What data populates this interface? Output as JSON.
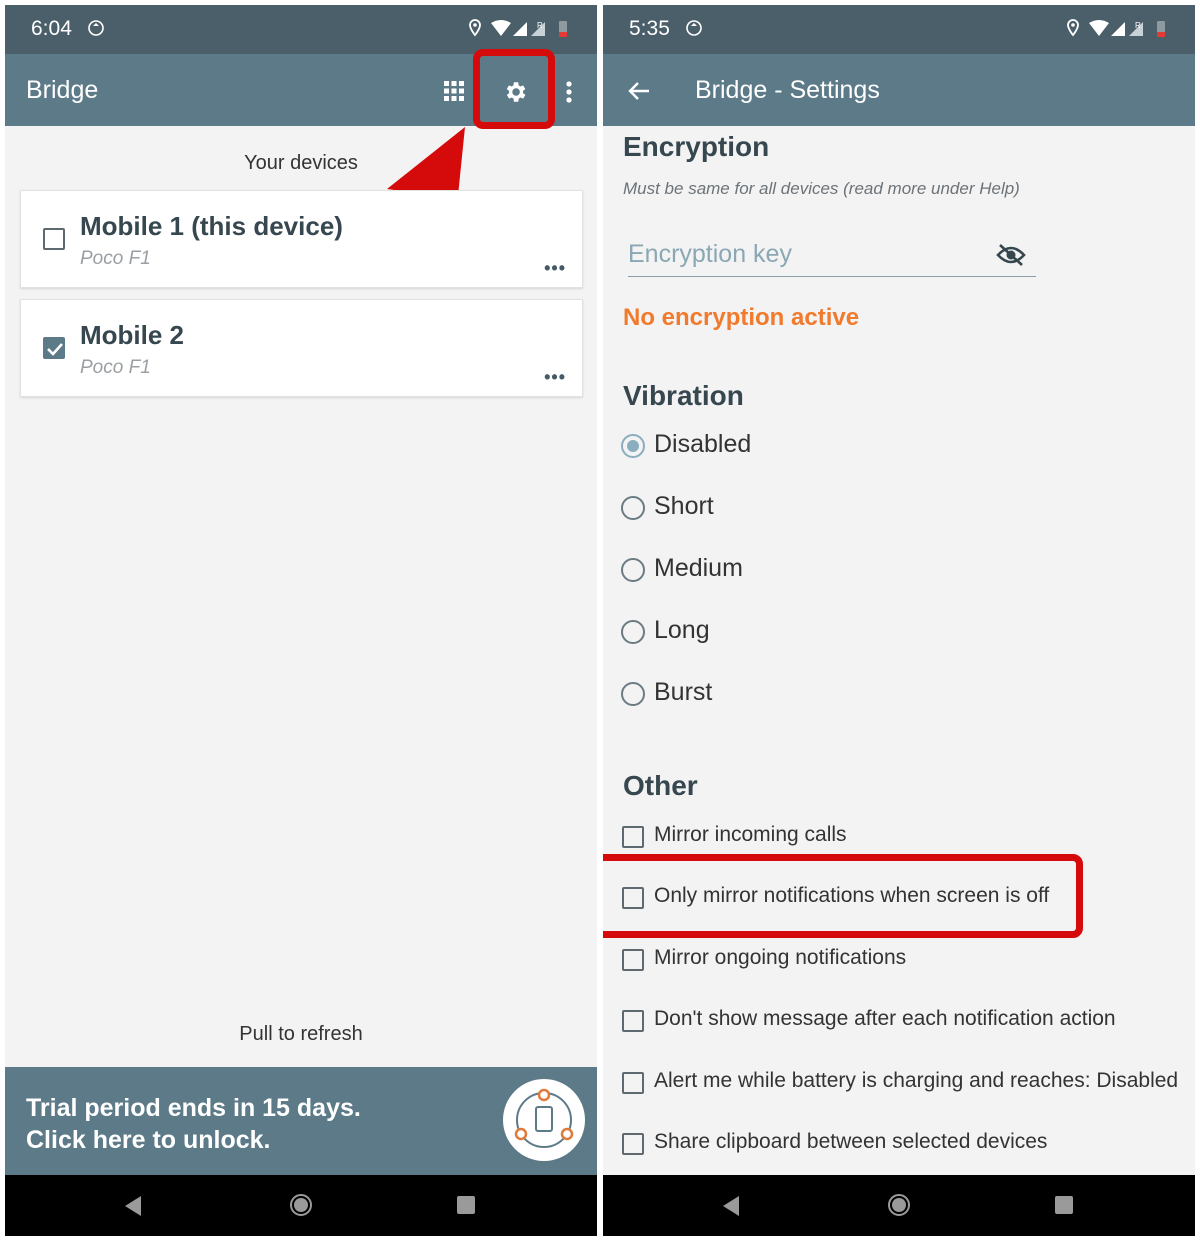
{
  "left": {
    "status": {
      "time": "6:04"
    },
    "appbar": {
      "title": "Bridge",
      "icons": [
        "grid-icon",
        "settings-gear-icon",
        "overflow-menu-icon"
      ]
    },
    "devices_caption": "Your devices",
    "devices": [
      {
        "name": "Mobile 1 (this device)",
        "model": "Poco F1",
        "checked": false,
        "more": "•••"
      },
      {
        "name": "Mobile 2",
        "model": "Poco F1",
        "checked": true,
        "more": "•••"
      }
    ],
    "pull_to_refresh": "Pull to refresh",
    "trial": {
      "line1": "Trial period ends in 15 days.",
      "line2": "Click here to unlock."
    }
  },
  "right": {
    "status": {
      "time": "5:35"
    },
    "appbar": {
      "title": "Bridge - Settings"
    },
    "encryption": {
      "title": "Encryption",
      "hint": "Must be same for all devices (read more under Help)",
      "placeholder": "Encryption key",
      "status": "No encryption active"
    },
    "vibration": {
      "title": "Vibration",
      "options": [
        "Disabled",
        "Short",
        "Medium",
        "Long",
        "Burst"
      ],
      "selected": "Disabled"
    },
    "other": {
      "title": "Other",
      "options": [
        "Mirror incoming calls",
        "Only mirror notifications when screen is off",
        "Mirror ongoing notifications",
        "Don't show message after each notification action",
        "Alert me while battery is charging and reaches: Disabled",
        "Share clipboard between selected devices"
      ]
    }
  },
  "colors": {
    "statusbar": "#4b5f6a",
    "appbar": "#5d7a88",
    "highlight": "#d50b0b",
    "warning": "#f17a2d"
  }
}
